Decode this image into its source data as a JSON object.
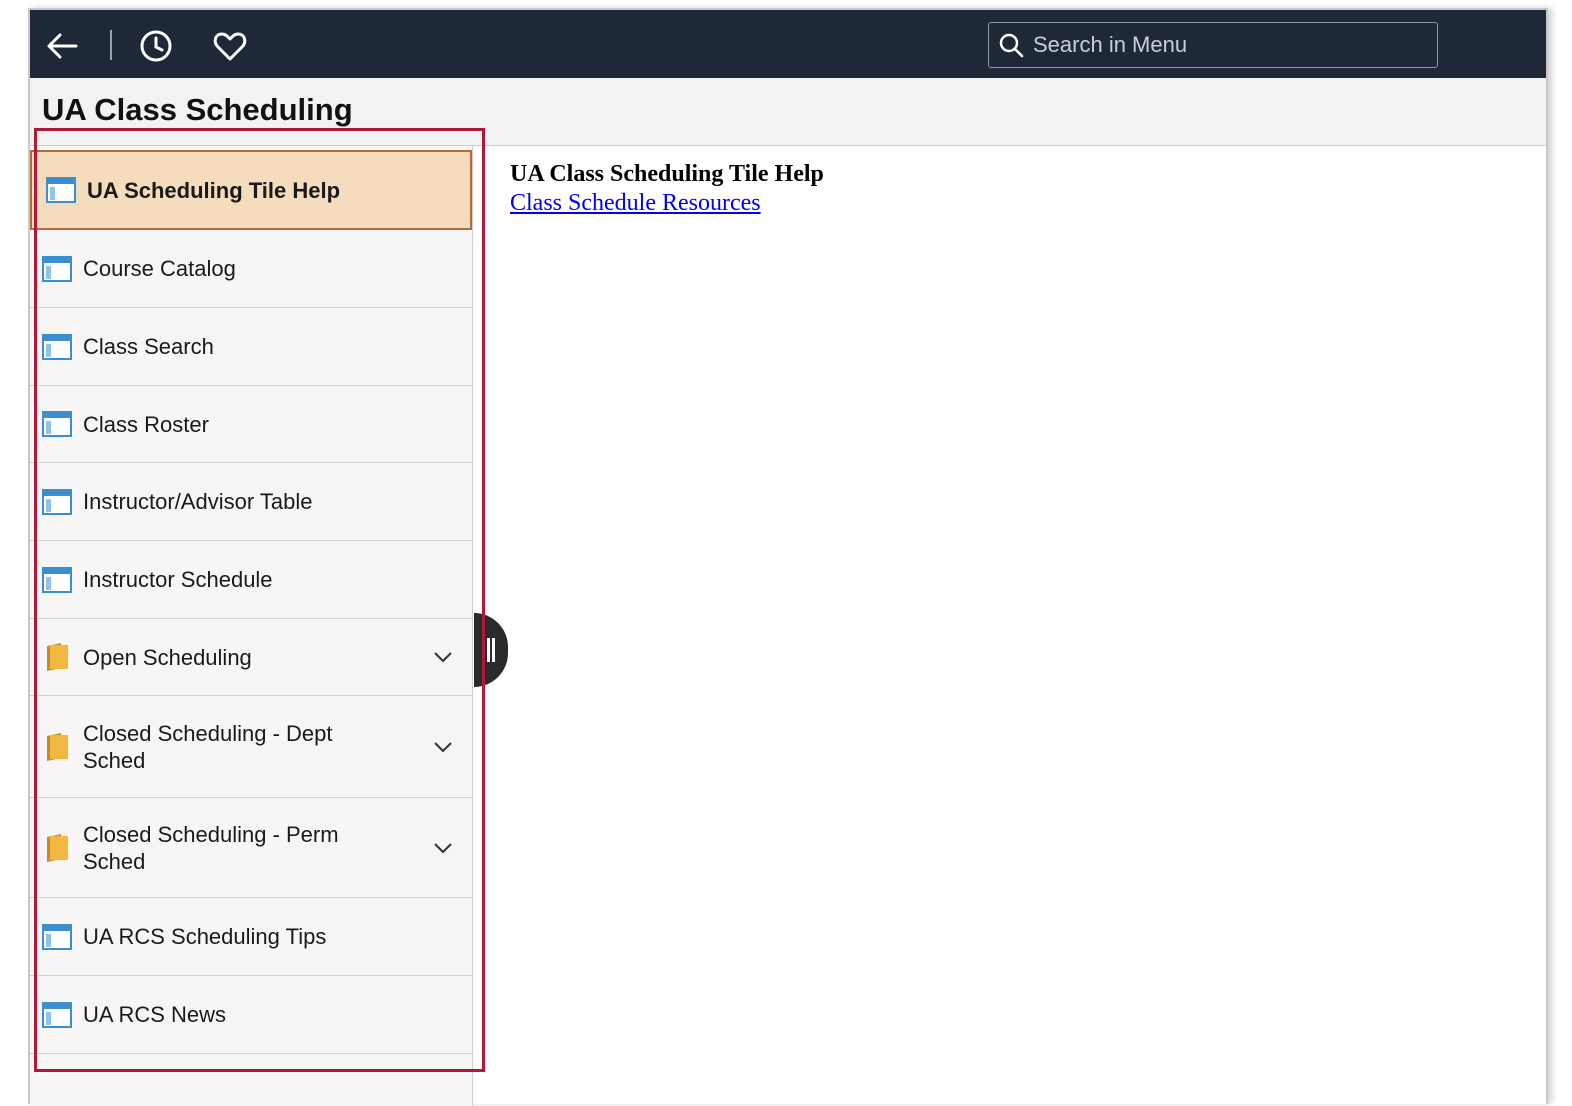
{
  "header": {
    "search_placeholder": "Search in Menu",
    "icons": [
      "back-arrow-icon",
      "history-clock-icon",
      "favorites-heart-icon",
      "search-icon"
    ]
  },
  "page": {
    "title": "UA Class Scheduling"
  },
  "sidebar": {
    "items": [
      {
        "label": "UA Scheduling Tile Help",
        "icon": "page-icon",
        "selected": true
      },
      {
        "label": "Course Catalog",
        "icon": "page-icon"
      },
      {
        "label": "Class Search",
        "icon": "page-icon"
      },
      {
        "label": "Class Roster",
        "icon": "page-icon"
      },
      {
        "label": "Instructor/Advisor Table",
        "icon": "page-icon"
      },
      {
        "label": "Instructor Schedule",
        "icon": "page-icon"
      },
      {
        "label": "Open Scheduling",
        "icon": "folder-icon",
        "expandable": true
      },
      {
        "label": "Closed Scheduling - Dept Sched",
        "icon": "folder-icon",
        "expandable": true
      },
      {
        "label": "Closed Scheduling - Perm Sched",
        "icon": "folder-icon",
        "expandable": true
      },
      {
        "label": "UA RCS Scheduling Tips",
        "icon": "page-icon"
      },
      {
        "label": "UA RCS News",
        "icon": "page-icon"
      }
    ]
  },
  "content": {
    "heading": "UA Class Scheduling Tile Help",
    "link": "Class Schedule Resources"
  },
  "colors": {
    "topbar": "#1e2836",
    "selected_bg": "#f5dcbc",
    "selected_border": "#b46a3c",
    "highlight_box": "#b0183a",
    "link": "#0000ee"
  }
}
